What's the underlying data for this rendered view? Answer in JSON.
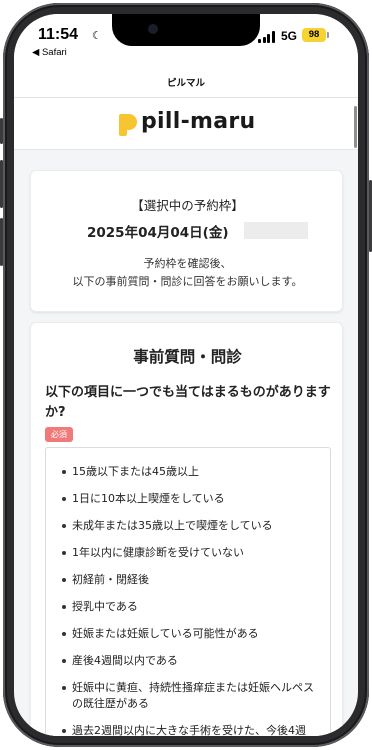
{
  "status_bar": {
    "time": "11:54",
    "moon_icon": "☾",
    "back_app": "◀ Safari",
    "network": "5G",
    "battery": "98"
  },
  "header": {
    "title": "ピルマル",
    "logo_text": "pill-maru",
    "logo_color": "#f7c531"
  },
  "reservation": {
    "heading": "【選択中の予約枠】",
    "date": "2025年04月04日(金)",
    "message_line1": "予約枠を確認後、",
    "message_line2": "以下の事前質問・問診に回答をお願いします。"
  },
  "questionnaire": {
    "title": "事前質問・問診",
    "question_line1": "以下の項目に一つでも当てはまるものがありますか?",
    "required_badge": "必須",
    "options": [
      "15歳以下または45歳以上",
      "1日に10本以上喫煙をしている",
      "未成年または35歳以上で喫煙をしている",
      "1年以内に健康診断を受けていない",
      "初経前・閉経後",
      "授乳中である",
      "妊娠または妊娠している可能性がある",
      "産後4週間以内である",
      "妊娠中に黄疸、持続性掻痒症または妊娠ヘルペスの既往歴がある",
      "過去2週間以内に大きな手術を受けた、今後4週"
    ]
  }
}
